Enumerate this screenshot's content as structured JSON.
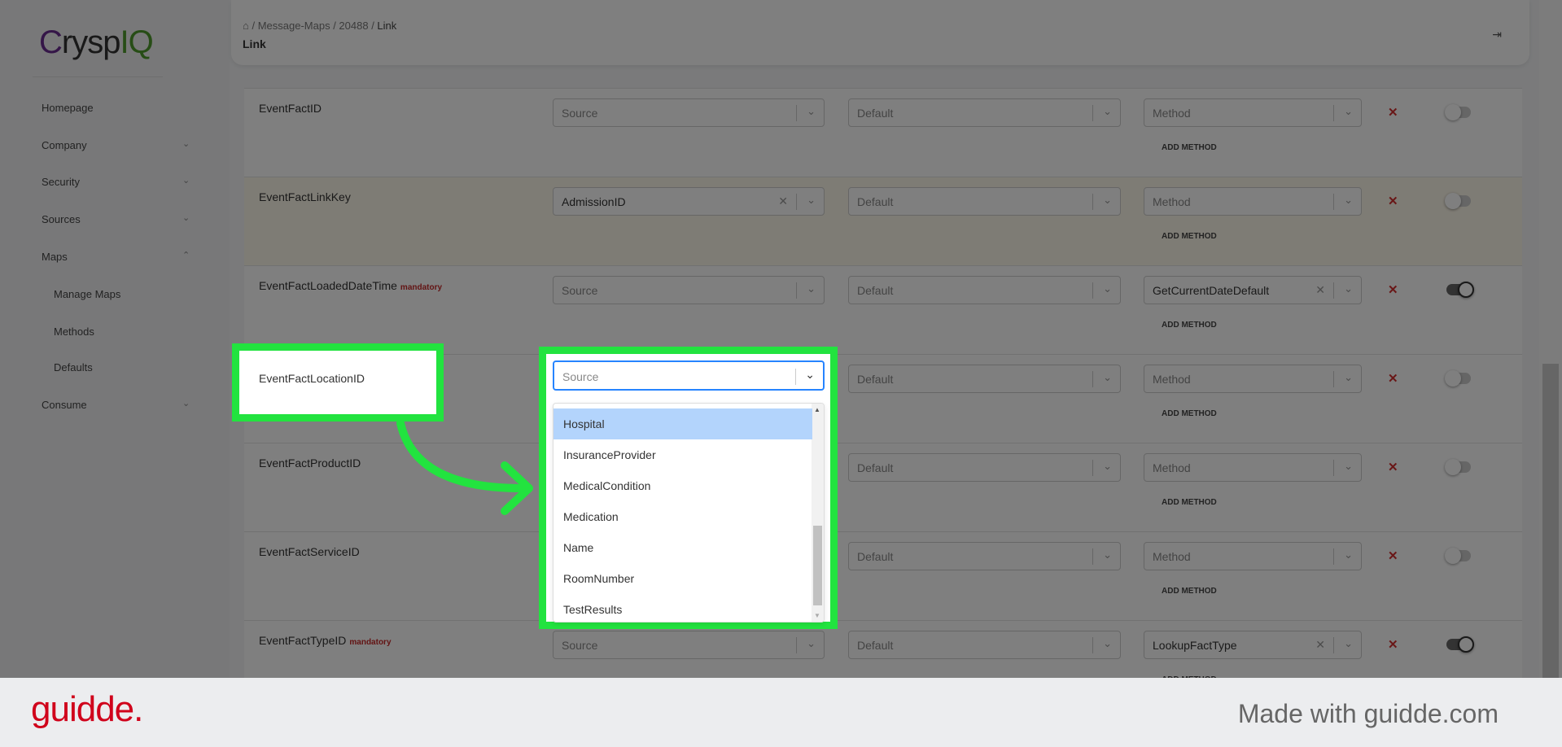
{
  "app": {
    "logo": "CryspIQ",
    "logo_parts": [
      "C",
      "rysp",
      "IQ"
    ]
  },
  "sidebar": {
    "items": [
      {
        "label": "Homepage",
        "chevron": ""
      },
      {
        "label": "Company",
        "chevron": "⌄"
      },
      {
        "label": "Security",
        "chevron": "⌄"
      },
      {
        "label": "Sources",
        "chevron": "⌄"
      },
      {
        "label": "Maps",
        "chevron": "⌃"
      },
      {
        "label": "Manage Maps",
        "sub": true
      },
      {
        "label": "Methods",
        "sub": true
      },
      {
        "label": "Defaults",
        "sub": true
      },
      {
        "label": "Consume",
        "chevron": "⌄"
      }
    ]
  },
  "header": {
    "breadcrumb": [
      "Message-Maps",
      "20488",
      "Link"
    ],
    "separator": "/",
    "title": "Link",
    "home_icon": "home-icon",
    "logout_icon": "logout-icon"
  },
  "rows": [
    {
      "label": "EventFactID",
      "mandatory": false,
      "source": "Source",
      "source_set": false,
      "default": "Default",
      "method": "Method",
      "method_set": false,
      "toggle": false
    },
    {
      "label": "EventFactLinkKey",
      "mandatory": false,
      "source": "AdmissionID",
      "source_set": true,
      "default": "Default",
      "method": "Method",
      "method_set": false,
      "toggle": false,
      "highlight": true
    },
    {
      "label": "EventFactLoadedDateTime",
      "mandatory": true,
      "source": "Source",
      "source_set": false,
      "default": "Default",
      "method": "GetCurrentDateDefault",
      "method_set": true,
      "toggle": true
    },
    {
      "label": "EventFactLocationID",
      "mandatory": false,
      "source": "Source",
      "source_set": false,
      "default": "Default",
      "method": "Method",
      "method_set": false,
      "toggle": false,
      "open": true
    },
    {
      "label": "EventFactProductID",
      "mandatory": false,
      "source": "Source",
      "source_set": false,
      "default": "Default",
      "method": "Method",
      "method_set": false,
      "toggle": false
    },
    {
      "label": "EventFactServiceID",
      "mandatory": false,
      "source": "Source",
      "source_set": false,
      "default": "Default",
      "method": "Method",
      "method_set": false,
      "toggle": false
    },
    {
      "label": "EventFactTypeID",
      "mandatory": true,
      "source": "Source",
      "source_set": false,
      "default": "Default",
      "method": "LookupFactType",
      "method_set": true,
      "toggle": true
    }
  ],
  "labels": {
    "mandatory": "mandatory",
    "add_method": "ADD METHOD"
  },
  "dropdown": {
    "placeholder": "Source",
    "options": [
      "Hospital",
      "InsuranceProvider",
      "MedicalCondition",
      "Medication",
      "Name",
      "RoomNumber",
      "TestResults"
    ],
    "highlighted": "Hospital"
  },
  "footer": {
    "brand": "guidde.",
    "tagline": "Made with guidde.com"
  },
  "colors": {
    "highlight": "#22e33f",
    "accent": "#2684ff",
    "danger": "#d32f2f",
    "brand": "#d0021b"
  }
}
